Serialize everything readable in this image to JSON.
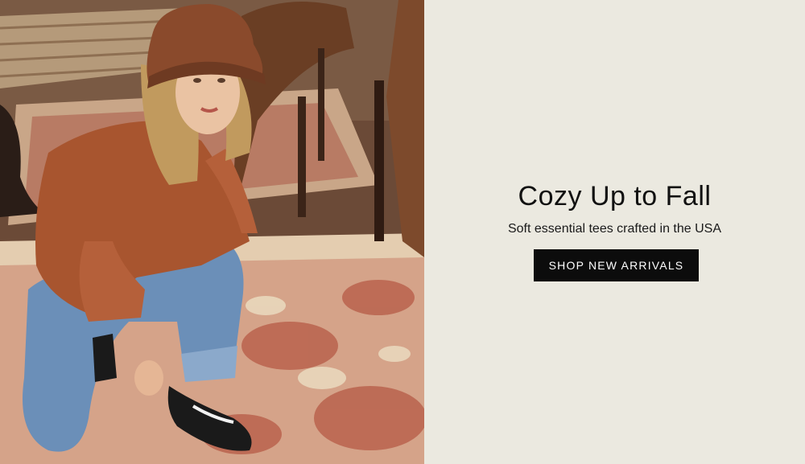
{
  "hero": {
    "image_alt": "Woman in rust bucket hat and sweatshirt kneeling on a patterned rug",
    "headline": "Cozy Up to Fall",
    "subheadline": "Soft essential tees crafted in the USA",
    "cta_label": "SHOP NEW ARRIVALS"
  },
  "colors": {
    "panel_bg": "#ebe9e0",
    "cta_bg": "#0c0c0c",
    "cta_text": "#ffffff",
    "heading_text": "#111111"
  }
}
